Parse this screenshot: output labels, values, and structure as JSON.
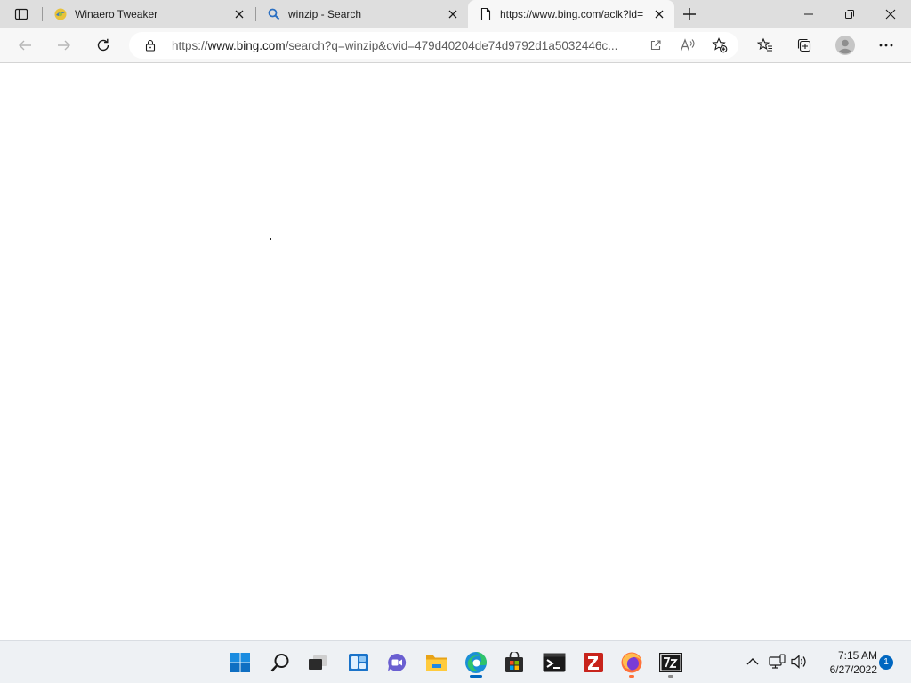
{
  "browser": {
    "tabs": [
      {
        "title": "Winaero Tweaker",
        "favicon": "winaero-icon",
        "active": false
      },
      {
        "title": "winzip - Search",
        "favicon": "search-icon",
        "active": false
      },
      {
        "title": "https://www.bing.com/aclk?ld=",
        "favicon": "page-icon",
        "active": true
      }
    ],
    "address": {
      "prefix": "https://",
      "host": "www.bing.com",
      "path": "/search?q=winzip&cvid=479d40204de74d9792d1a5032446c..."
    }
  },
  "taskbar": {
    "apps": [
      "start-icon",
      "search-icon",
      "task-view-icon",
      "widgets-icon",
      "chat-icon",
      "file-explorer-icon",
      "edge-icon",
      "store-icon",
      "terminal-icon",
      "filezilla-icon",
      "firefox-icon",
      "7zip-icon"
    ],
    "clock": {
      "time": "7:15 AM",
      "date": "6/27/2022"
    },
    "notification_count": "1",
    "accent": "#0067c0"
  }
}
